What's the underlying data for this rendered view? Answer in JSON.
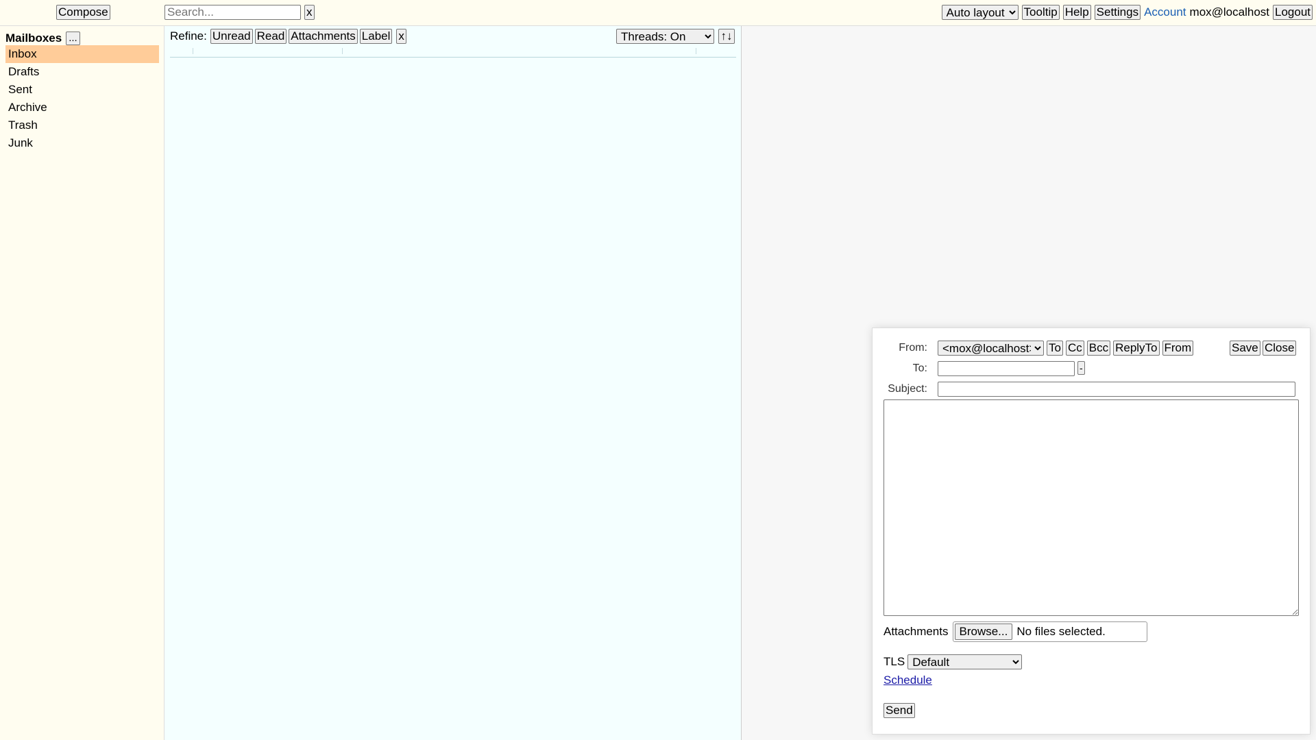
{
  "topbar": {
    "compose_label": "Compose",
    "search_placeholder": "Search...",
    "search_value": "",
    "search_clear_label": "x",
    "layout_select": "Auto layout",
    "tooltip_label": "Tooltip",
    "help_label": "Help",
    "settings_label": "Settings",
    "account_label": "Account",
    "user_email": "mox@localhost",
    "logout_label": "Logout"
  },
  "sidebar": {
    "title": "Mailboxes",
    "more_label": "...",
    "items": [
      {
        "label": "Inbox",
        "active": true
      },
      {
        "label": "Drafts",
        "active": false
      },
      {
        "label": "Sent",
        "active": false
      },
      {
        "label": "Archive",
        "active": false
      },
      {
        "label": "Trash",
        "active": false
      },
      {
        "label": "Junk",
        "active": false
      }
    ]
  },
  "list": {
    "refine_label": "Refine:",
    "filters": [
      "Unread",
      "Read",
      "Attachments",
      "Label"
    ],
    "filter_clear_label": "x",
    "threads_select": "Threads: On",
    "sort_label": "↑↓"
  },
  "compose": {
    "from_label": "From:",
    "from_value": "<mox@localhost>",
    "add_buttons": [
      "To",
      "Cc",
      "Bcc",
      "ReplyTo",
      "From"
    ],
    "save_label": "Save",
    "close_label": "Close",
    "to_label": "To:",
    "to_value": "",
    "to_remove_label": "-",
    "subject_label": "Subject:",
    "subject_value": "",
    "body_value": "",
    "attachments_label": "Attachments",
    "browse_label": "Browse...",
    "file_status": "No files selected.",
    "tls_label": "TLS",
    "tls_value": "Default",
    "schedule_label": "Schedule",
    "send_label": "Send"
  },
  "colors": {
    "topbar_bg": "#fffdf0",
    "sidebar_bg": "#fffdf0",
    "active_mailbox": "#ffcc99",
    "list_bg": "#f4ffff",
    "link": "#1a5fb4"
  }
}
